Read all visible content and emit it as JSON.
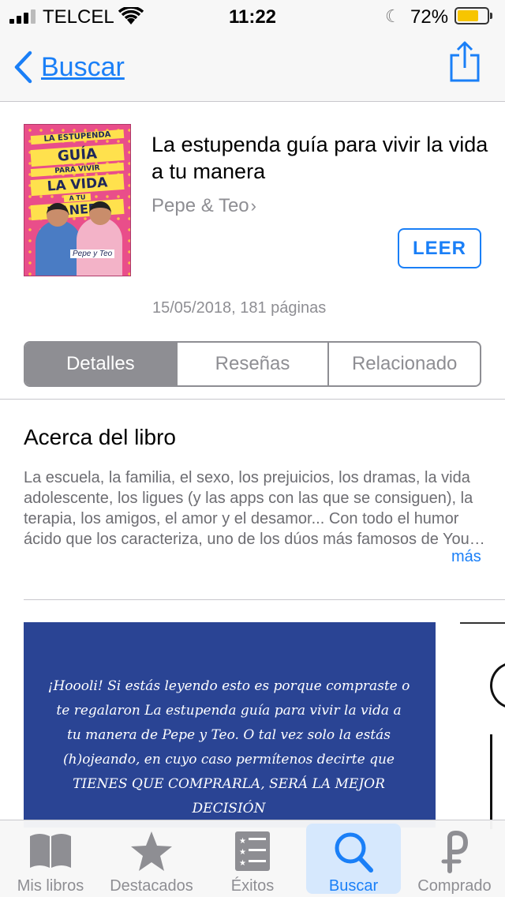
{
  "status_bar": {
    "carrier": "TELCEL",
    "time": "11:22",
    "battery_percent": "72%",
    "battery_level": 0.72,
    "signal_bars": 3
  },
  "nav": {
    "back_label": "Buscar",
    "share_icon": "share-icon"
  },
  "book": {
    "title": "La estupenda guía para vivir la vida a tu manera",
    "author": "Pepe & Teo",
    "read_button": "LEER",
    "meta": "15/05/2018, 181 páginas",
    "cover": {
      "line1": "LA ESTUPENDA",
      "line2": "GUÍA",
      "line3": "PARA VIVIR",
      "line4": "LA VIDA",
      "line5": "A TU",
      "line6": "MANERA",
      "signature": "Pepe y Teo"
    }
  },
  "segments": [
    {
      "label": "Detalles",
      "active": true
    },
    {
      "label": "Reseñas",
      "active": false
    },
    {
      "label": "Relacionado",
      "active": false
    }
  ],
  "about": {
    "heading": "Acerca del libro",
    "text": "La escuela, la familia, el sexo, los prejuicios, los dramas, la vida adolescente, los ligues (y las apps con las que se consiguen), la terapia, los amigos, el amor y el desamor... Con todo el humor ácido que los caracteriza, uno de los dúos más famosos de You…",
    "more": "más"
  },
  "preview": {
    "text": "¡Hoooli! Si estás leyendo esto es porque compraste o te regalaron La estupenda guía para vivir la vida a tu manera de Pepe y Teo. O tal vez solo la estás (h)ojeando, en cuyo caso permítenos decirte que TIENES QUE COMPRARLA, SERÁ LA MEJOR DECISIÓN"
  },
  "tabs": [
    {
      "label": "Mis libros",
      "icon": "book-icon",
      "active": false
    },
    {
      "label": "Destacados",
      "icon": "star-icon",
      "active": false
    },
    {
      "label": "Éxitos",
      "icon": "list-icon",
      "active": false
    },
    {
      "label": "Buscar",
      "icon": "search-icon",
      "active": true
    },
    {
      "label": "Comprado",
      "icon": "purchased-icon",
      "active": false
    }
  ],
  "colors": {
    "accent": "#1a7ff7",
    "secondary_text": "#8e8e93",
    "preview_bg": "#2a4494",
    "cover_bg": "#e94e8a"
  }
}
